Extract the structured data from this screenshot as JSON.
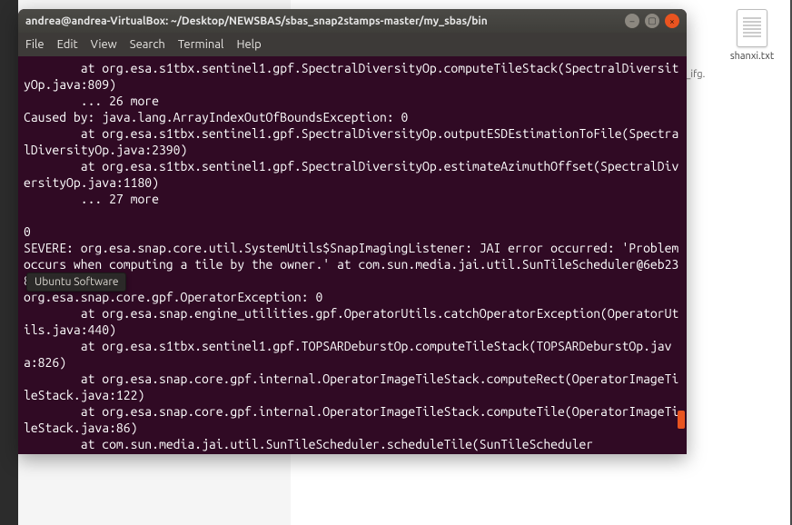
{
  "desktop": {
    "file_name": "shanxi.txt",
    "bg_label": "_ifg."
  },
  "tooltip": {
    "text": "Ubuntu Software"
  },
  "terminal": {
    "titlebar": {
      "title": "andrea@andrea-VirtualBox: ~/Desktop/NEWSBAS/sbas_snap2stamps-master/my_sbas/bin"
    },
    "menubar": {
      "file": "File",
      "edit": "Edit",
      "view": "View",
      "search": "Search",
      "terminal": "Terminal",
      "help": "Help"
    },
    "output": "        at org.esa.s1tbx.sentinel1.gpf.SpectralDiversityOp.computeTileStack(SpectralDiversityOp.java:809)\n        ... 26 more\nCaused by: java.lang.ArrayIndexOutOfBoundsException: 0\n        at org.esa.s1tbx.sentinel1.gpf.SpectralDiversityOp.outputESDEstimationToFile(SpectralDiversityOp.java:2390)\n        at org.esa.s1tbx.sentinel1.gpf.SpectralDiversityOp.estimateAzimuthOffset(SpectralDiversityOp.java:1180)\n        ... 27 more\n\n0\nSEVERE: org.esa.snap.core.util.SystemUtils$SnapImagingListener: JAI error occurred: 'Problem occurs when computing a tile by the owner.' at com.sun.media.jai.util.SunTileScheduler@6eb23846\norg.esa.snap.core.gpf.OperatorException: 0\n        at org.esa.snap.engine_utilities.gpf.OperatorUtils.catchOperatorException(OperatorUtils.java:440)\n        at org.esa.s1tbx.sentinel1.gpf.TOPSARDeburstOp.computeTileStack(TOPSARDeburstOp.java:826)\n        at org.esa.snap.core.gpf.internal.OperatorImageTileStack.computeRect(OperatorImageTileStack.java:122)\n        at org.esa.snap.core.gpf.internal.OperatorImageTileStack.computeTile(OperatorImageTileStack.java:86)\n        at com.sun.media.jai.util.SunTileScheduler.scheduleTile(SunTileScheduler"
  }
}
